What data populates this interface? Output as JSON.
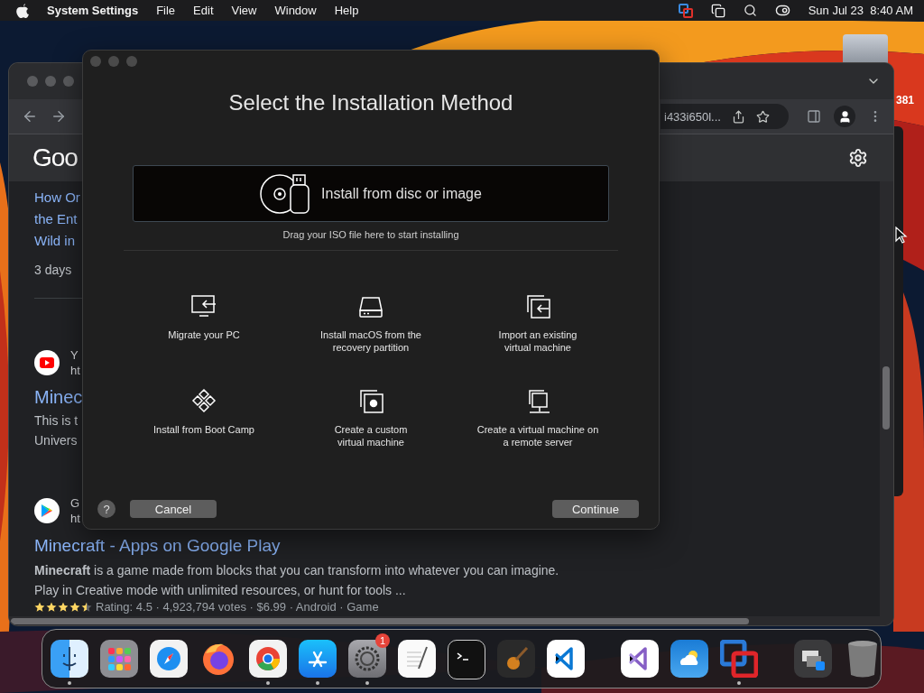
{
  "menu_bar": {
    "app": "System Settings",
    "menus": [
      "File",
      "Edit",
      "View",
      "Window",
      "Help"
    ],
    "clock": "Sun Jul 23  8:40 AM"
  },
  "desktop": {
    "edge_text": "381"
  },
  "browser": {
    "address": "i433i650l...",
    "logo": "Goo",
    "results": [
      {
        "kind": "article",
        "title_lines": [
          "How Or",
          "the Ent",
          "Wild in"
        ],
        "meta": "3 days"
      },
      {
        "kind": "video_site",
        "site": "Y",
        "url": "ht",
        "title": "Minec",
        "snippet_lines": [
          "This is t",
          "Univers"
        ]
      },
      {
        "kind": "store_site",
        "site": "G",
        "url": "ht",
        "title": "Minecraft - Apps on Google Play",
        "snippet_lines": [
          "**Minecraft** is a game made from blocks that you can transform into whatever you can imagine.",
          "Play in Creative mode with unlimited resources, or hunt for tools ..."
        ],
        "stars": 4.5,
        "rating": "Rating: 4.5 · 4,923,794 votes · $6.99 · Android · Game"
      }
    ]
  },
  "dialog": {
    "title": "Select the Installation Method",
    "drop_zone": "Install from disc or image",
    "drop_hint": "Drag your ISO file here to start installing",
    "options": [
      {
        "kind": "migrate",
        "lines": [
          "Migrate your PC"
        ]
      },
      {
        "kind": "recovery",
        "lines": [
          "Install macOS from the",
          "recovery partition"
        ]
      },
      {
        "kind": "import",
        "lines": [
          "Import an existing",
          "virtual machine"
        ]
      },
      {
        "kind": "bootcamp",
        "lines": [
          "Install from Boot Camp"
        ]
      },
      {
        "kind": "custom",
        "lines": [
          "Create a custom",
          "virtual machine"
        ]
      },
      {
        "kind": "remote",
        "lines": [
          "Create a virtual machine on",
          "a remote server"
        ]
      }
    ],
    "help": "?",
    "cancel": "Cancel",
    "continue": "Continue"
  },
  "dock": {
    "groups": [
      [
        {
          "kind": "finder",
          "running": true
        },
        {
          "kind": "launchpad",
          "running": false
        },
        {
          "kind": "safari",
          "running": false
        },
        {
          "kind": "firefox",
          "running": false
        },
        {
          "kind": "chrome",
          "running": true
        },
        {
          "kind": "appstore",
          "running": true
        },
        {
          "kind": "settings",
          "running": true,
          "badge": "1"
        },
        {
          "kind": "textedit",
          "running": false
        },
        {
          "kind": "terminal",
          "running": false
        },
        {
          "kind": "garageband",
          "running": false
        },
        {
          "kind": "vscode",
          "running": false
        }
      ],
      [
        {
          "kind": "visualstudio",
          "running": false
        },
        {
          "kind": "weather",
          "running": false
        },
        {
          "kind": "vmware",
          "running": true
        }
      ],
      [
        {
          "kind": "downloads",
          "running": false
        },
        {
          "kind": "trash",
          "running": false
        }
      ]
    ]
  }
}
